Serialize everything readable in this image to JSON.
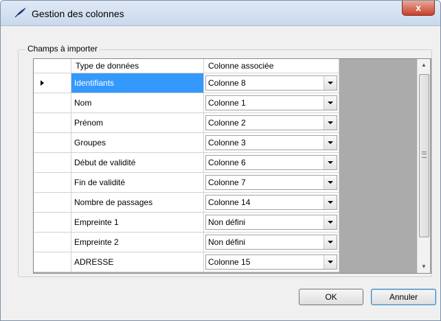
{
  "window": {
    "title": "Gestion des colonnes",
    "close_label": "x"
  },
  "group": {
    "label": "Champs à importer"
  },
  "grid": {
    "columns": [
      "Type de données",
      "Colonne associée"
    ],
    "rows": [
      {
        "type": "Identifiants",
        "column": "Colonne 8",
        "selected": true
      },
      {
        "type": "Nom",
        "column": "Colonne 1"
      },
      {
        "type": "Prénom",
        "column": "Colonne 2"
      },
      {
        "type": "Groupes",
        "column": "Colonne 3"
      },
      {
        "type": "Début de validité",
        "column": "Colonne 6"
      },
      {
        "type": "Fin de validité",
        "column": "Colonne 7"
      },
      {
        "type": "Nombre de passages",
        "column": "Colonne 14"
      },
      {
        "type": "Empreinte 1",
        "column": "Non défini"
      },
      {
        "type": "Empreinte 2",
        "column": "Non défini"
      },
      {
        "type": "ADRESSE",
        "column": "Colonne 15"
      }
    ]
  },
  "buttons": {
    "ok": "OK",
    "cancel": "Annuler"
  },
  "colors": {
    "selection": "#3399ff",
    "grid_background": "#ababab"
  }
}
